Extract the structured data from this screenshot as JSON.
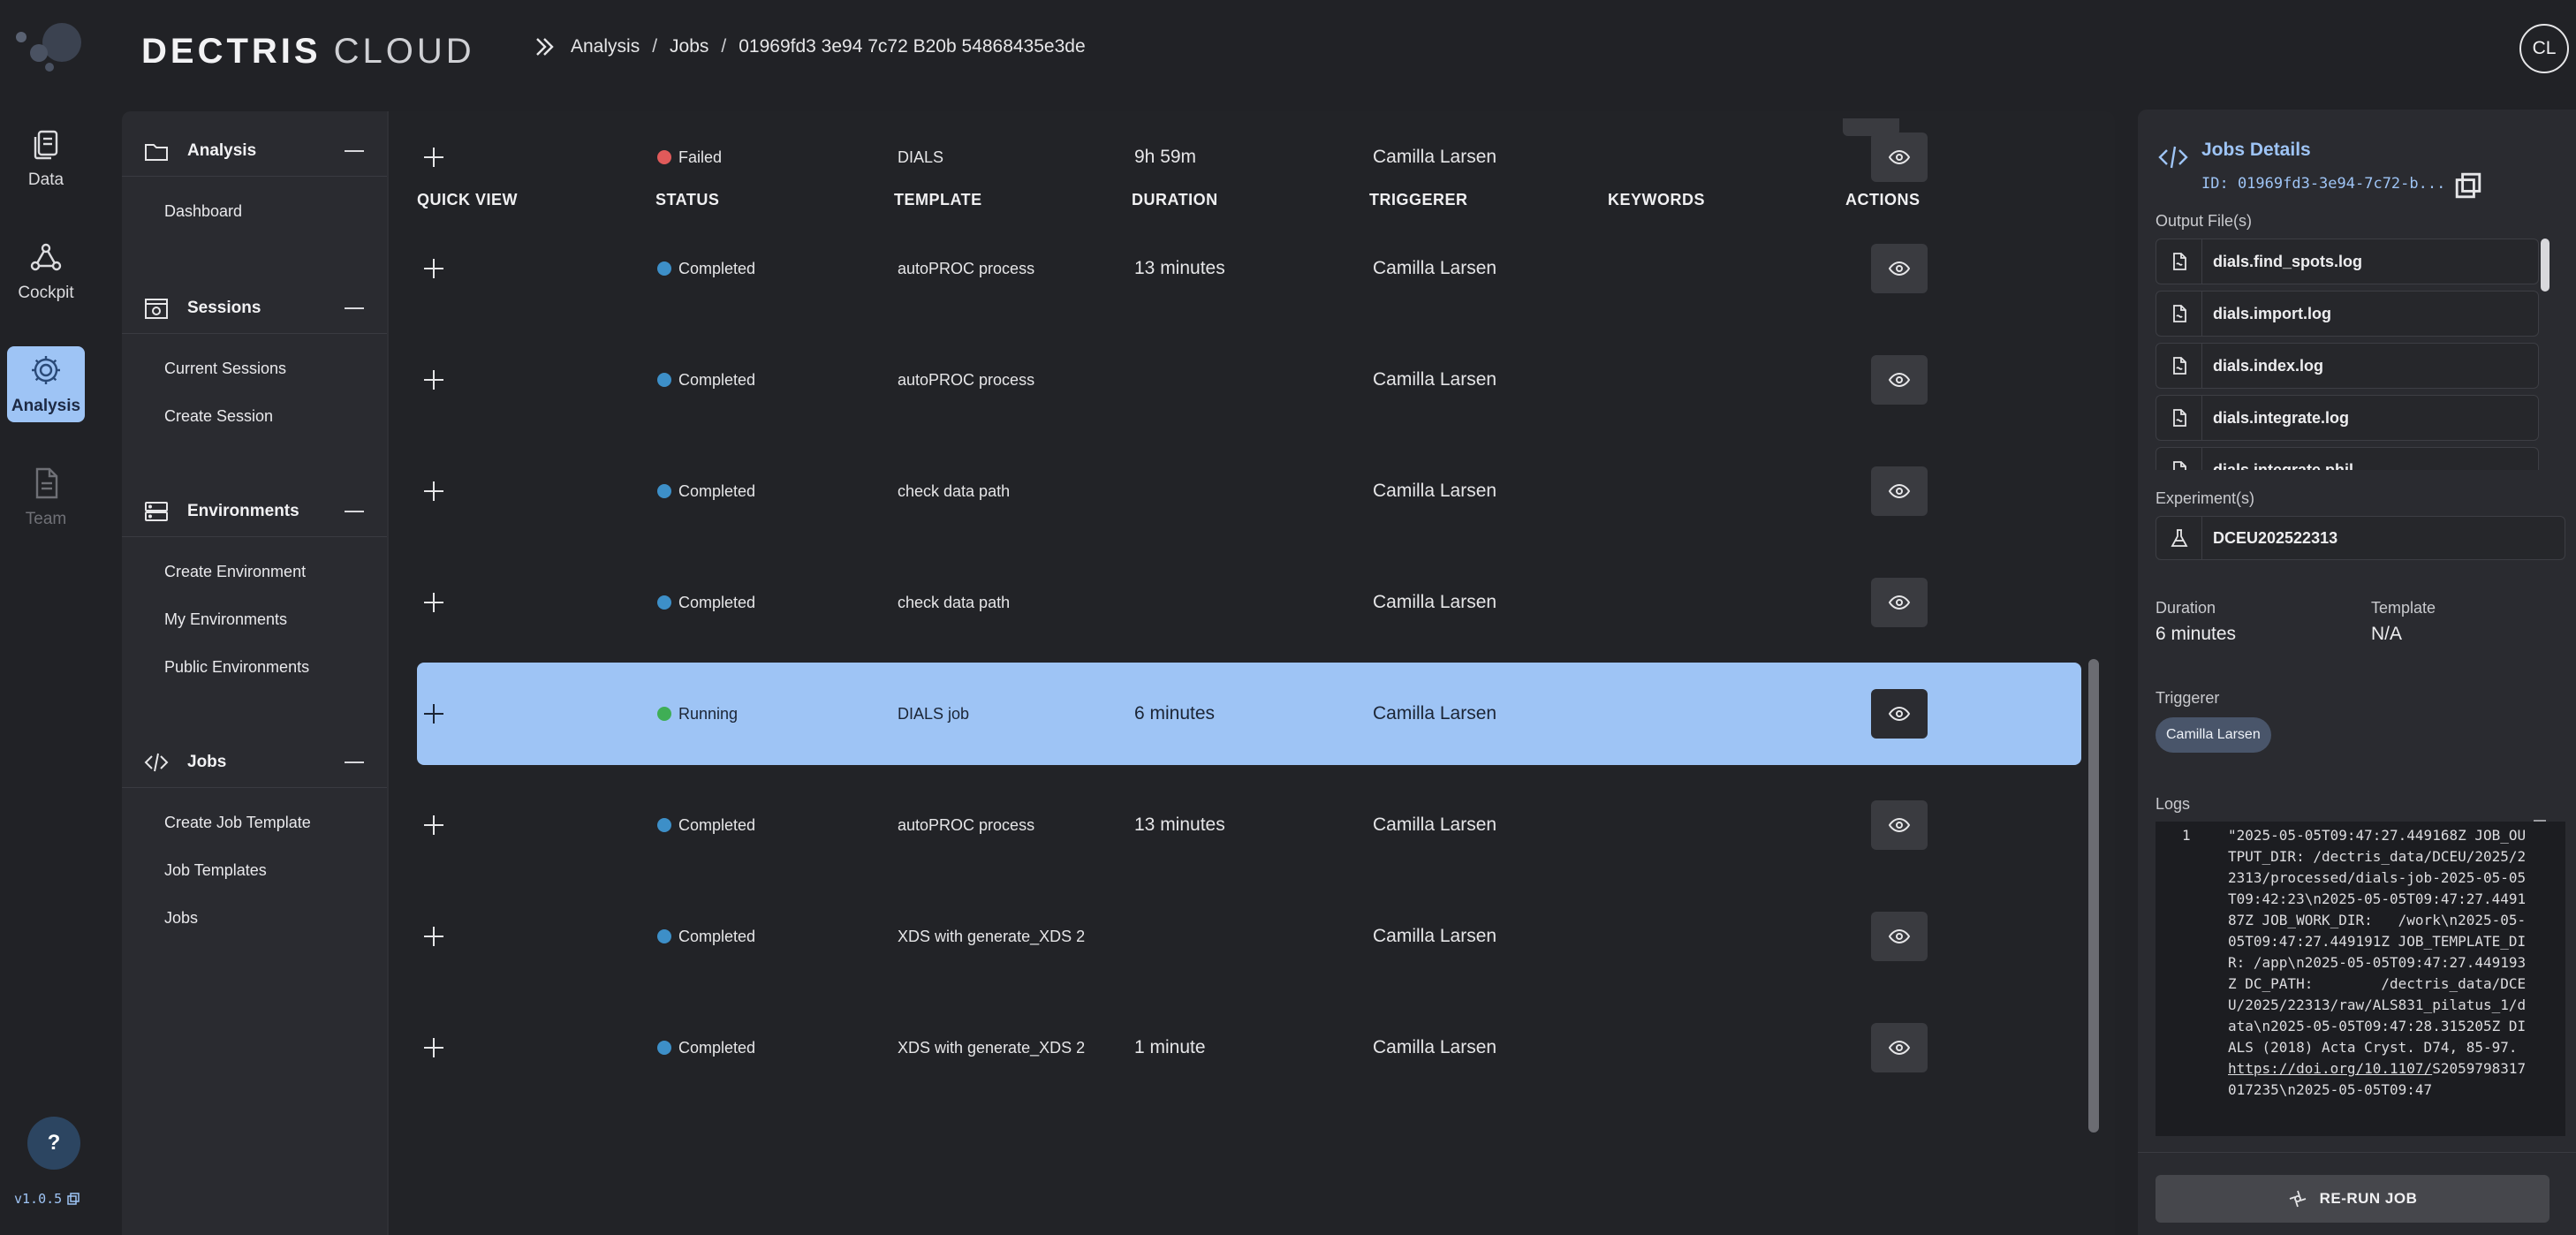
{
  "brand": {
    "bold": "DECTRIS",
    "light": "CLOUD"
  },
  "breadcrumb": [
    "Analysis",
    "Jobs",
    "01969fd3 3e94 7c72 B20b 54868435e3de"
  ],
  "user_initials": "CL",
  "version": "v1.0.5",
  "help_label": "?",
  "rail": [
    {
      "label": "Data",
      "icon": "data-icon"
    },
    {
      "label": "Cockpit",
      "icon": "cockpit-icon"
    },
    {
      "label": "Analysis",
      "icon": "gear-icon",
      "active": true
    },
    {
      "label": "Team",
      "icon": "document-icon"
    }
  ],
  "nav": {
    "analysis": {
      "title": "Analysis",
      "items": [
        "Dashboard"
      ]
    },
    "sessions": {
      "title": "Sessions",
      "items": [
        "Current Sessions",
        "Create Session"
      ]
    },
    "environments": {
      "title": "Environments",
      "items": [
        "Create Environment",
        "My Environments",
        "Public Environments"
      ]
    },
    "jobs": {
      "title": "Jobs",
      "items": [
        "Create Job Template",
        "Job Templates",
        "Jobs"
      ]
    }
  },
  "table": {
    "columns": [
      "QUICK VIEW",
      "STATUS",
      "TEMPLATE",
      "DURATION",
      "TRIGGERER",
      "KEYWORDS",
      "ACTIONS"
    ],
    "rows": [
      {
        "status": "Failed",
        "status_color": "#e05a5a",
        "template": "DIALS",
        "duration": "9h 59m",
        "triggerer": "Camilla Larsen",
        "keywords": ""
      },
      {
        "status": "Completed",
        "status_color": "#3d8fc8",
        "template": "autoPROC process",
        "duration": "13 minutes",
        "triggerer": "Camilla Larsen",
        "keywords": ""
      },
      {
        "status": "Completed",
        "status_color": "#3d8fc8",
        "template": "autoPROC process",
        "duration": "",
        "triggerer": "Camilla Larsen",
        "keywords": ""
      },
      {
        "status": "Completed",
        "status_color": "#3d8fc8",
        "template": "check data path",
        "duration": "",
        "triggerer": "Camilla Larsen",
        "keywords": ""
      },
      {
        "status": "Completed",
        "status_color": "#3d8fc8",
        "template": "check data path",
        "duration": "",
        "triggerer": "Camilla Larsen",
        "keywords": ""
      },
      {
        "status": "Running",
        "status_color": "#3fae55",
        "template": "DIALS job",
        "duration": "6 minutes",
        "triggerer": "Camilla Larsen",
        "keywords": "",
        "selected": true
      },
      {
        "status": "Completed",
        "status_color": "#3d8fc8",
        "template": "autoPROC process",
        "duration": "13 minutes",
        "triggerer": "Camilla Larsen",
        "keywords": ""
      },
      {
        "status": "Completed",
        "status_color": "#3d8fc8",
        "template": "XDS with generate_XDS 2",
        "duration": "",
        "triggerer": "Camilla Larsen",
        "keywords": ""
      },
      {
        "status": "Completed",
        "status_color": "#3d8fc8",
        "template": "XDS with generate_XDS 2",
        "duration": "1 minute",
        "triggerer": "Camilla Larsen",
        "keywords": ""
      }
    ]
  },
  "details": {
    "title": "Jobs Details",
    "id": "ID: 01969fd3-3e94-7c72-b...",
    "output_files_label": "Output File(s)",
    "output_files": [
      "dials.find_spots.log",
      "dials.import.log",
      "dials.index.log",
      "dials.integrate.log",
      "dials.integrate.phil"
    ],
    "experiments_label": "Experiment(s)",
    "experiment": "DCEU202522313",
    "duration_label": "Duration",
    "duration": "6 minutes",
    "template_label": "Template",
    "template": "N/A",
    "triggerer_label": "Triggerer",
    "triggerer": "Camilla Larsen",
    "logs_label": "Logs",
    "log_line_number": "1",
    "log_text_before_link": "\"2025-05-05T09:47:27.449168Z JOB_OUTPUT_DIR: /dectris_data/DCEU/2025/22313/processed/dials-job-2025-05-05T09:42:23\\n2025-05-05T09:47:27.449187Z JOB_WORK_DIR:   /work\\n2025-05-05T09:47:27.449191Z JOB_TEMPLATE_DIR: /app\\n2025-05-05T09:47:27.449193Z DC_PATH:        /dectris_data/DCEU/2025/22313/raw/ALS831_pilatus_1/data\\n2025-05-05T09:47:28.315205Z DIALS (2018) Acta Cryst. D74, 85-97. ",
    "log_link": "https://doi.org/10.1107/",
    "log_text_after_link": "S2059798317017235\\n2025-05-05T09:47",
    "rerun_label": "RE-RUN JOB"
  }
}
